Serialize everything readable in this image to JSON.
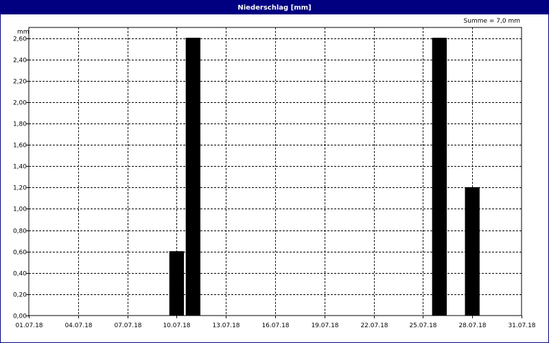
{
  "title": "Niederschlag [mm]",
  "summary": "Summe = 7,0 mm",
  "chart_data": {
    "type": "bar",
    "title": "Niederschlag [mm]",
    "ylabel": "mm",
    "xlabel": "",
    "ylim": [
      0,
      2.7
    ],
    "yticks": [
      0,
      0.2,
      0.4,
      0.6,
      0.8,
      1.0,
      1.2,
      1.4,
      1.6,
      1.8,
      2.0,
      2.2,
      2.4,
      2.6
    ],
    "ytick_labels": [
      "0,00",
      "0,20",
      "0,40",
      "0,60",
      "0,80",
      "1,00",
      "1,20",
      "1,40",
      "1,60",
      "1,80",
      "2,00",
      "2,20",
      "2,40",
      "2,60"
    ],
    "xticks": [
      "01.07.18",
      "04.07.18",
      "07.07.18",
      "10.07.18",
      "13.07.18",
      "16.07.18",
      "19.07.18",
      "22.07.18",
      "25.07.18",
      "28.07.18",
      "31.07.18"
    ],
    "bars": [
      {
        "date": "10.07.18",
        "value": 0.6
      },
      {
        "date": "11.07.18",
        "value": 2.6
      },
      {
        "date": "26.07.18",
        "value": 2.6
      },
      {
        "date": "28.07.18",
        "value": 1.2
      }
    ],
    "grid": true,
    "bar_color": "#000000"
  },
  "colors": {
    "title_bar": "#000080",
    "title_text": "#ffffff",
    "grid": "#000000"
  }
}
